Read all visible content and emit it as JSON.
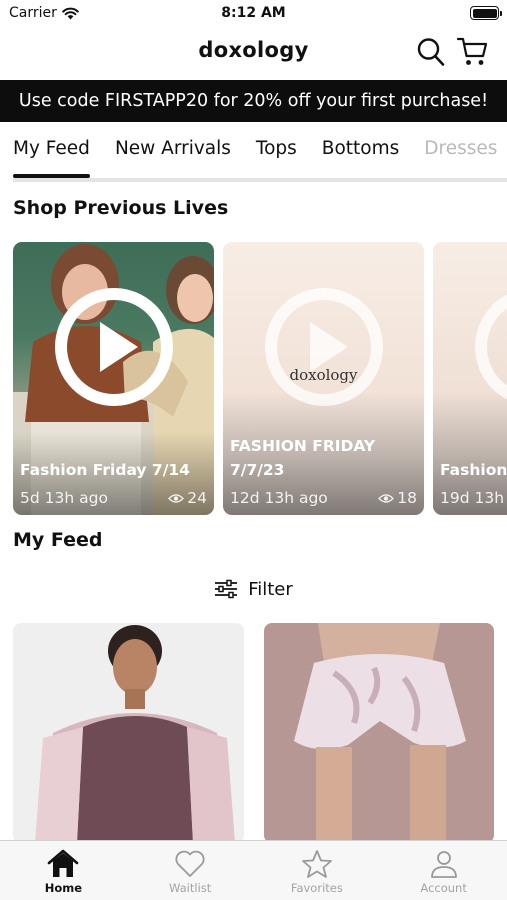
{
  "status": {
    "carrier": "Carrier",
    "time": "8:12 AM"
  },
  "header": {
    "brand": "doxology"
  },
  "promo": {
    "text": "Use code FIRSTAPP20 for 20% off your first purchase!"
  },
  "tabs": [
    {
      "label": "My Feed",
      "active": true
    },
    {
      "label": "New Arrivals"
    },
    {
      "label": "Tops"
    },
    {
      "label": "Bottoms"
    },
    {
      "label": "Dresses"
    }
  ],
  "lives": {
    "title": "Shop Previous Lives",
    "cards": [
      {
        "title": "Fashion Friday 7/14",
        "age": "5d 13h ago",
        "views": "24"
      },
      {
        "title_line1": "FASHION FRIDAY",
        "title_line2": "7/7/23",
        "logo_text": "doxology",
        "age": "12d 13h ago",
        "views": "18"
      },
      {
        "title": "Fashion",
        "age": "19d 13h"
      }
    ]
  },
  "feed": {
    "title": "My Feed",
    "filter_label": "Filter"
  },
  "tab_bar": [
    {
      "label": "Home",
      "icon": "home-icon",
      "active": true
    },
    {
      "label": "Waitlist",
      "icon": "heart-icon"
    },
    {
      "label": "Favorites",
      "icon": "star-icon"
    },
    {
      "label": "Account",
      "icon": "person-icon"
    }
  ],
  "colors": {
    "promo_bg": "#0d0d0d",
    "active_tab": "#111111",
    "inactive_tab_bar": "#a3a3a3"
  }
}
